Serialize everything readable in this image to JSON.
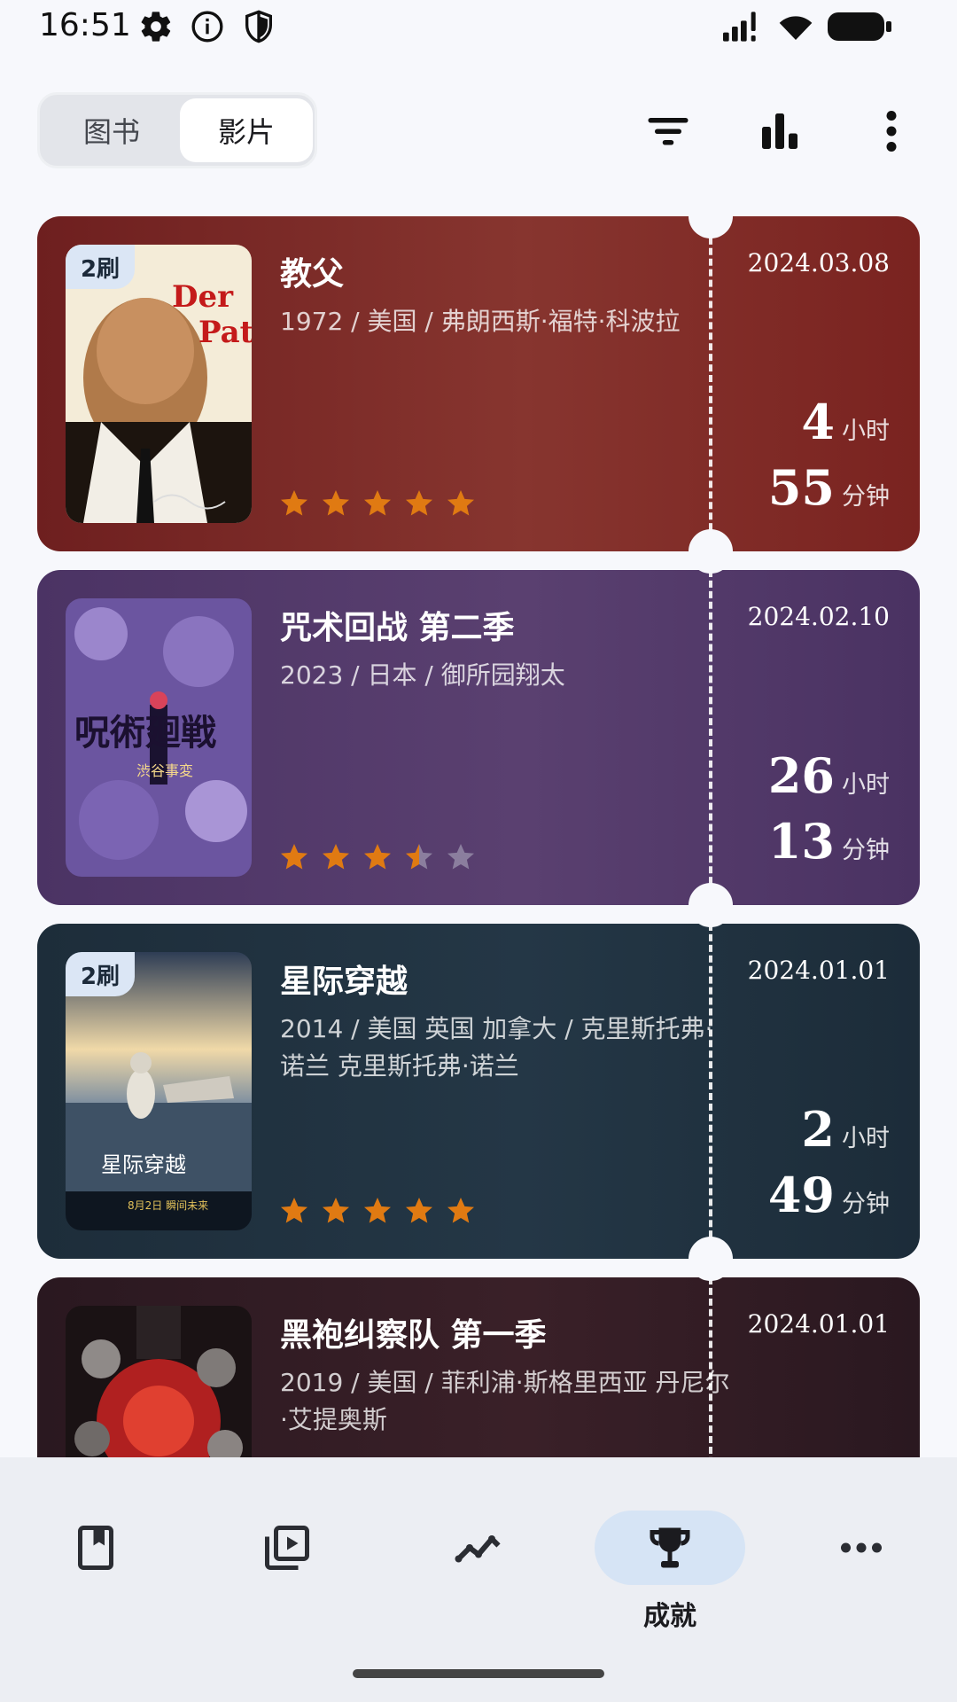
{
  "status_bar": {
    "time": "16:51",
    "icons": [
      "gear-icon",
      "info-icon",
      "shield-icon",
      "signal-icon",
      "wifi-icon",
      "battery-icon"
    ]
  },
  "header": {
    "segments": [
      {
        "label": "图书",
        "selected": false
      },
      {
        "label": "影片",
        "selected": true
      }
    ],
    "actions": [
      "filter-icon",
      "bar-chart-icon",
      "more-vert-icon"
    ]
  },
  "films": [
    {
      "title": "教父",
      "meta": "1972 / 美国 / 弗朗西斯·福特·科波拉",
      "date": "2024.03.08",
      "hours": "4",
      "minutes": "55",
      "hours_unit": "小时",
      "minutes_unit": "分钟",
      "rating": 5,
      "badge": "2刷",
      "color": "#7e2a26"
    },
    {
      "title": "咒术回战 第二季",
      "meta": "2023 / 日本 / 御所园翔太",
      "date": "2024.02.10",
      "hours": "26",
      "minutes": "13",
      "hours_unit": "小时",
      "minutes_unit": "分钟",
      "rating": 3.5,
      "badge": "",
      "color": "#4f3868"
    },
    {
      "title": "星际穿越",
      "meta": "2014 / 美国 英国 加拿大 / 克里斯托弗·诺兰 克里斯托弗·诺兰",
      "date": "2024.01.01",
      "hours": "2",
      "minutes": "49",
      "hours_unit": "小时",
      "minutes_unit": "分钟",
      "rating": 5,
      "badge": "2刷",
      "color": "#1f3140"
    },
    {
      "title": "黑袍纠察队 第一季",
      "meta": "2019 / 美国 / 菲利浦·斯格里西亚 丹尼尔·艾提奥斯",
      "date": "2024.01.01",
      "hours": "",
      "minutes": "",
      "hours_unit": "",
      "minutes_unit": "",
      "rating": 0,
      "badge": "",
      "color": "#2e1b22"
    }
  ],
  "colors": {
    "star": "#e07a12",
    "star_empty": "#8b7e9e",
    "active_nav": "#d6e4f5"
  },
  "bottom_nav": [
    {
      "icon": "book-icon",
      "label": ""
    },
    {
      "icon": "video-library-icon",
      "label": ""
    },
    {
      "icon": "trend-icon",
      "label": ""
    },
    {
      "icon": "trophy-icon",
      "label": "成就",
      "active": true
    },
    {
      "icon": "more-horiz-icon",
      "label": ""
    }
  ]
}
